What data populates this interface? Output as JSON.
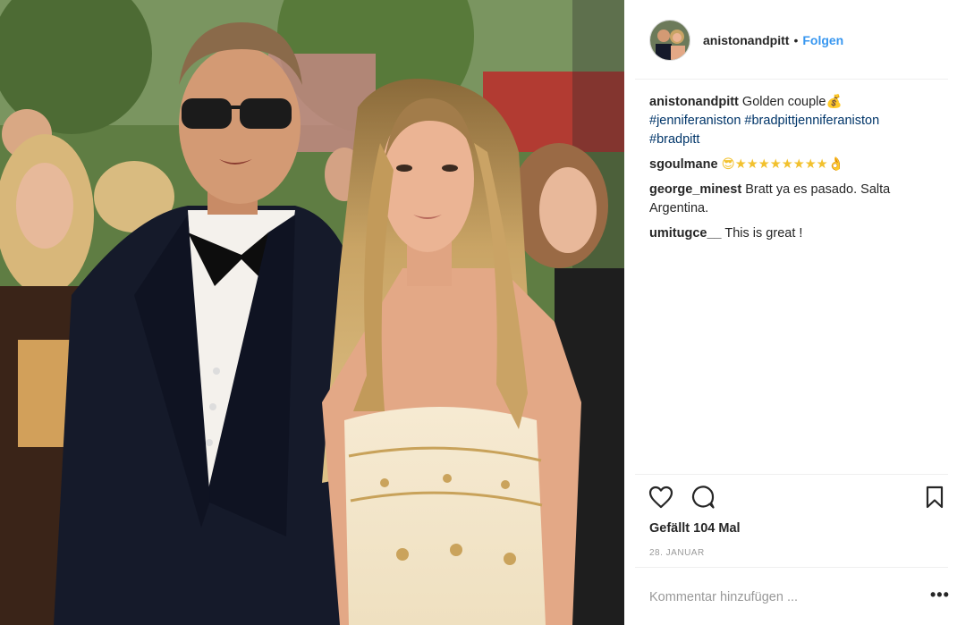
{
  "post": {
    "username": "anistonandpitt",
    "separator": "•",
    "follow_label": "Folgen",
    "photo_icon": "image",
    "avatar_icon": "avatar"
  },
  "comments": [
    {
      "user": "anistonandpitt",
      "text": "Golden couple",
      "emoji": "💰",
      "tags": [
        "#jenniferaniston",
        "#bradpittjenniferaniston",
        "#bradpitt"
      ]
    },
    {
      "user": "sgoulmane",
      "text": "😎★★★★★★★★👌"
    },
    {
      "user": "george_minest",
      "text": "Bratt ya es pasado. Salta Argentina."
    },
    {
      "user": "umitugce__",
      "text": "This is great !"
    }
  ],
  "actions": {
    "like_icon": "heart-icon",
    "comment_icon": "comment-icon",
    "save_icon": "bookmark-icon"
  },
  "likes_text": "Gefällt 104 Mal",
  "date_text": "28. JANUAR",
  "comment_input": {
    "placeholder": "Kommentar hinzufügen ...",
    "value": ""
  },
  "more_label": "•••",
  "colors": {
    "link": "#3897f0",
    "hashtag": "#003569",
    "muted": "#999999",
    "border": "#efefef"
  }
}
